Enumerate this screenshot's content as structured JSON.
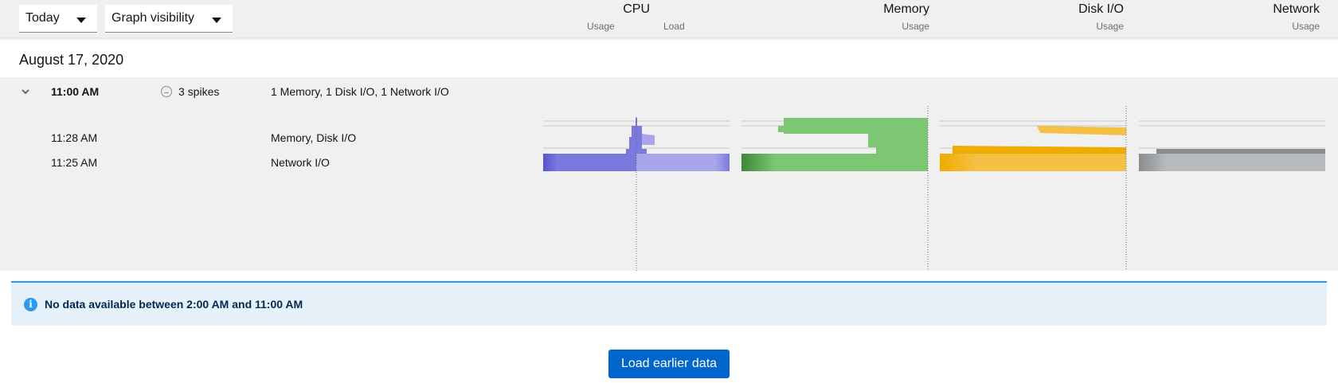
{
  "toolbar": {
    "range_select": "Today",
    "visibility_select": "Graph visibility"
  },
  "columns": {
    "cpu": {
      "title": "CPU",
      "sub1": "Usage",
      "sub2": "Load"
    },
    "memory": {
      "title": "Memory",
      "sub": "Usage"
    },
    "disk": {
      "title": "Disk I/O",
      "sub": "Usage"
    },
    "network": {
      "title": "Network",
      "sub": "Usage"
    }
  },
  "day": {
    "date": "August 17, 2020"
  },
  "group": {
    "hour": "11:00 AM",
    "spikes": "3 spikes",
    "summary": "1 Memory, 1 Disk I/O, 1 Network I/O",
    "events": [
      {
        "time": "11:28 AM",
        "desc": "Memory, Disk I/O"
      },
      {
        "time": "11:25 AM",
        "desc": "Network I/O"
      }
    ]
  },
  "alert": {
    "message": "No data available between 2:00 AM and 11:00 AM"
  },
  "load_button": "Load earlier data",
  "colors": {
    "cpu_usage": "#7b78de",
    "cpu_load": "#a8a5e8",
    "memory": "#7cc674",
    "disk": "#f4c145",
    "network": "#b8bbbe",
    "accent": "#0066cc",
    "info": "#2b9af3"
  }
}
